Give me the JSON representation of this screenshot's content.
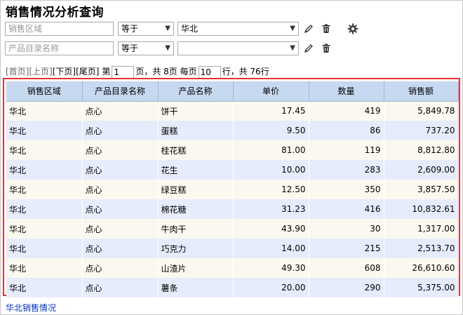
{
  "page": {
    "title": "销售情况分析查询"
  },
  "filters": [
    {
      "field_placeholder": "销售区域",
      "operator": "等于",
      "value": "华北"
    },
    {
      "field_placeholder": "产品目录名称",
      "operator": "等于",
      "value": ""
    }
  ],
  "icons": {
    "edit": "pencil-icon",
    "delete": "trash-icon",
    "settings": "gear-icon",
    "dropdown": "chevron-down-icon"
  },
  "pager": {
    "first": "[首页]",
    "prev": "[上页]",
    "next": "[下页]",
    "last": "[尾页]",
    "page_prefix": "第",
    "page_value": "1",
    "page_suffix": "页，共 8页 每页",
    "size_value": "10",
    "size_suffix": "行，共 76行"
  },
  "table": {
    "columns": [
      "销售区域",
      "产品目录名称",
      "产品名称",
      "单价",
      "数量",
      "销售额"
    ],
    "rows": [
      [
        "华北",
        "点心",
        "饼干",
        "17.45",
        "419",
        "5,849.78"
      ],
      [
        "华北",
        "点心",
        "蛋糕",
        "9.50",
        "86",
        "737.20"
      ],
      [
        "华北",
        "点心",
        "桂花糕",
        "81.00",
        "119",
        "8,812.80"
      ],
      [
        "华北",
        "点心",
        "花生",
        "10.00",
        "283",
        "2,609.00"
      ],
      [
        "华北",
        "点心",
        "绿豆糕",
        "12.50",
        "350",
        "3,857.50"
      ],
      [
        "华北",
        "点心",
        "棉花糖",
        "31.23",
        "416",
        "10,832.61"
      ],
      [
        "华北",
        "点心",
        "牛肉干",
        "43.90",
        "30",
        "1,317.00"
      ],
      [
        "华北",
        "点心",
        "巧克力",
        "14.00",
        "215",
        "2,513.70"
      ],
      [
        "华北",
        "点心",
        "山渣片",
        "49.30",
        "608",
        "26,610.60"
      ],
      [
        "华北",
        "点心",
        "薯条",
        "20.00",
        "290",
        "5,375.00"
      ]
    ]
  },
  "footer": {
    "link": "华北销售情况"
  },
  "colors": {
    "header_bg": "#c6d9f0",
    "row_odd": "#fbf9ef",
    "row_even": "#e6ecfb",
    "highlight_border": "#e53333",
    "link": "#0033cc"
  }
}
